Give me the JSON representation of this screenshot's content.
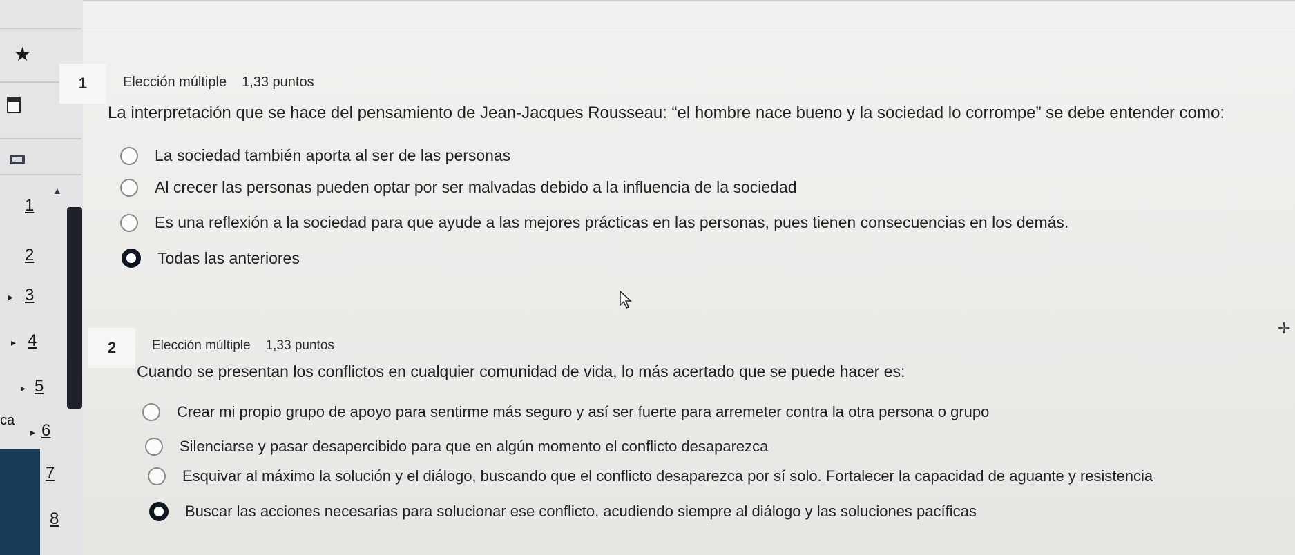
{
  "sidebar": {
    "nav_numbers": [
      "1",
      "2",
      "3",
      "4",
      "5",
      "6",
      "7",
      "8"
    ],
    "side_text": "ca"
  },
  "questions": [
    {
      "number": "1",
      "type": "Elección múltiple",
      "points": "1,33 puntos",
      "text": "La interpretación que se hace del pensamiento de Jean-Jacques Rousseau: “el hombre nace bueno y la sociedad lo corrompe” se debe entender como:",
      "options": [
        {
          "label": "La sociedad también aporta al ser de las personas",
          "selected": false
        },
        {
          "label": "Al crecer las personas pueden optar por ser malvadas debido a la influencia de la sociedad",
          "selected": false
        },
        {
          "label": "Es una reflexión a la sociedad para que ayude a las mejores prácticas en las personas, pues tienen consecuencias en los demás.",
          "selected": false
        },
        {
          "label": "Todas las anteriores",
          "selected": true
        }
      ]
    },
    {
      "number": "2",
      "type": "Elección múltiple",
      "points": "1,33 puntos",
      "text": "Cuando se presentan los conflictos en cualquier comunidad de vida, lo más acertado que se puede hacer es:",
      "options": [
        {
          "label": "Crear mi propio grupo de apoyo para sentirme más seguro y así ser fuerte para arremeter contra la otra persona o grupo",
          "selected": false
        },
        {
          "label": "Silenciarse y pasar desapercibido para que en algún momento el conflicto desaparezca",
          "selected": false
        },
        {
          "label": "Esquivar al máximo la solución y el diálogo, buscando que el conflicto desaparezca por sí solo. Fortalecer la capacidad de aguante y resistencia",
          "selected": false
        },
        {
          "label": "Buscar las acciones necesarias para solucionar ese conflicto, acudiendo siempre al diálogo y las soluciones pacíficas",
          "selected": true
        }
      ]
    }
  ]
}
